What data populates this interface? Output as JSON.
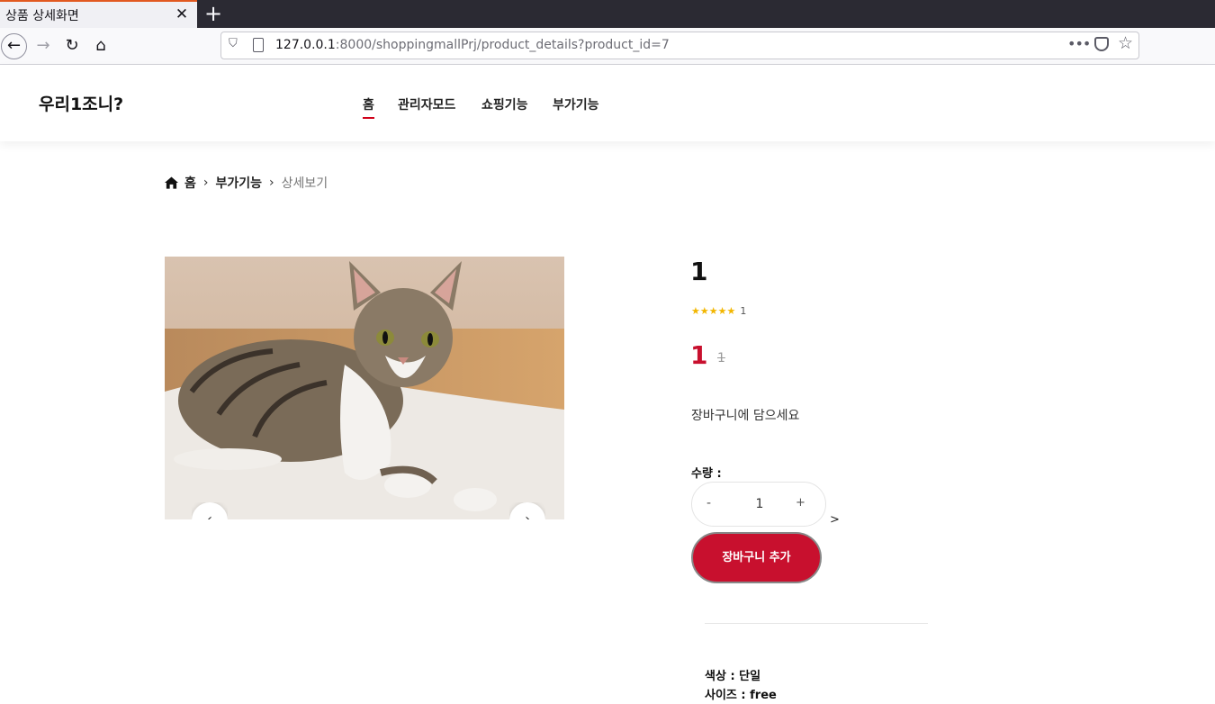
{
  "browser": {
    "tab_title": "상품 상세화면",
    "tab_close": "✕",
    "new_tab": "+",
    "url_host": "127.0.0.1",
    "url_path": ":8000/shoppingmallPrj/product_details?product_id=7",
    "more": "•••"
  },
  "site": {
    "logo": "우리1조니?",
    "menu": [
      "홈",
      "관리자모드",
      "쇼핑기능",
      "부가기능"
    ]
  },
  "breadcrumb": {
    "home": "홈",
    "section": "부가기능",
    "current": "상세보기"
  },
  "product": {
    "name": "1",
    "rating_stars": 5,
    "rating_count": "1",
    "price": "1",
    "old_price": "1",
    "description": "장바구니에 담으세요",
    "quantity_label": "수량 :",
    "quantity": "1",
    "minus": "-",
    "plus": "+",
    "stray_text": ">",
    "add_to_cart": "장바구니 추가",
    "options": [
      "색상 : 단일",
      "사이즈 : free"
    ]
  },
  "carousel": {
    "prev": "‹",
    "next": "›"
  },
  "colors": {
    "accent": "#c8102e",
    "star": "#f2b600"
  }
}
